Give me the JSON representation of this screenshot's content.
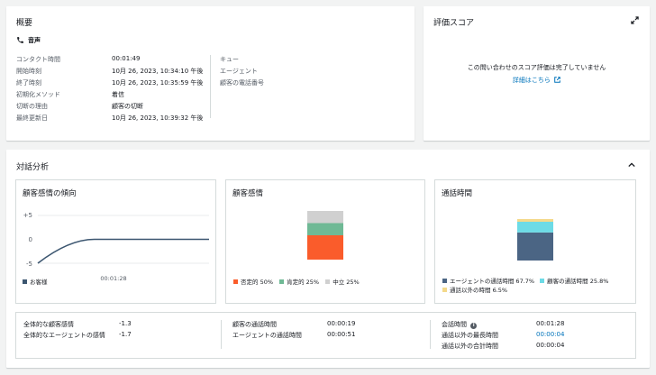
{
  "summary": {
    "title": "概要",
    "channel_label": "音声",
    "left_rows": [
      {
        "label": "コンタクト時間",
        "value": "00:01:49"
      },
      {
        "label": "開始時刻",
        "value": "10月 26, 2023, 10:34:10 午後"
      },
      {
        "label": "終了時刻",
        "value": "10月 26, 2023, 10:35:59 午後"
      },
      {
        "label": "初期化メソッド",
        "value": "着信"
      },
      {
        "label": "切断の理由",
        "value": "顧客の切断"
      },
      {
        "label": "最終更新日",
        "value": "10月 26, 2023, 10:39:32 午後"
      }
    ],
    "right_rows": [
      "キュー",
      "エージェント",
      "顧客の電話番号"
    ]
  },
  "score": {
    "title": "評価スコア",
    "message": "この問い合わせのスコア評価は完了していません",
    "link": "詳細はこちら"
  },
  "analysis": {
    "title": "対話分析",
    "trend": {
      "title": "顧客感情の傾向",
      "y_ticks": [
        "+5",
        "0",
        "-5"
      ],
      "x_tick": "00:01:28",
      "legend": "お客様"
    },
    "sentiment": {
      "title": "顧客感情",
      "legend": [
        "否定的 50%",
        "肯定的 25%",
        "中立 25%"
      ]
    },
    "talk": {
      "title": "通話時間",
      "legend": [
        "エージェントの通話時間 67.7%",
        "顧客の通話時間 25.8%",
        "通話以外の時間 6.5%"
      ]
    },
    "stats": {
      "col1": [
        {
          "label": "全体的な顧客感情",
          "value": "-1.3"
        },
        {
          "label": "全体的なエージェントの感情",
          "value": "-1.7"
        }
      ],
      "col2": [
        {
          "label": "顧客の通話時間",
          "value": "00:00:19"
        },
        {
          "label": "エージェントの通話時間",
          "value": "00:00:51"
        }
      ],
      "col3": [
        {
          "label": "会話時間",
          "value": "00:01:28"
        },
        {
          "label": "通話以外の最長時間",
          "value": "00:00:04"
        },
        {
          "label": "通話以外の合計時間",
          "value": "00:00:04"
        }
      ]
    }
  },
  "chart_data": [
    {
      "type": "line",
      "title": "顧客感情の傾向",
      "y_ticks": [
        "+5",
        "0",
        "-5"
      ],
      "ylim": [
        -5,
        5
      ],
      "series": [
        {
          "name": "お客様",
          "x": [
            0,
            0.33,
            1.0
          ],
          "values": [
            -5,
            0,
            0
          ]
        }
      ],
      "grid": true
    },
    {
      "type": "bar",
      "title": "顧客感情",
      "stacked": true,
      "series": [
        {
          "name": "否定的",
          "values": [
            50
          ]
        },
        {
          "name": "肯定的",
          "values": [
            25
          ]
        },
        {
          "name": "中立",
          "values": [
            25
          ]
        }
      ]
    },
    {
      "type": "bar",
      "title": "通話時間",
      "stacked": true,
      "series": [
        {
          "name": "エージェントの通話時間",
          "values": [
            67.7
          ]
        },
        {
          "name": "顧客の通話時間",
          "values": [
            25.8
          ]
        },
        {
          "name": "通話以外の時間",
          "values": [
            6.5
          ]
        }
      ]
    }
  ],
  "colors": {
    "negative": "#fa5c2b",
    "positive": "#6fb995",
    "neutral": "#d0d0d0",
    "agent": "#4b6584",
    "customer": "#6ddbe6",
    "nontalk": "#f4d98b",
    "line": "#3c5670",
    "link": "#0073bb"
  }
}
